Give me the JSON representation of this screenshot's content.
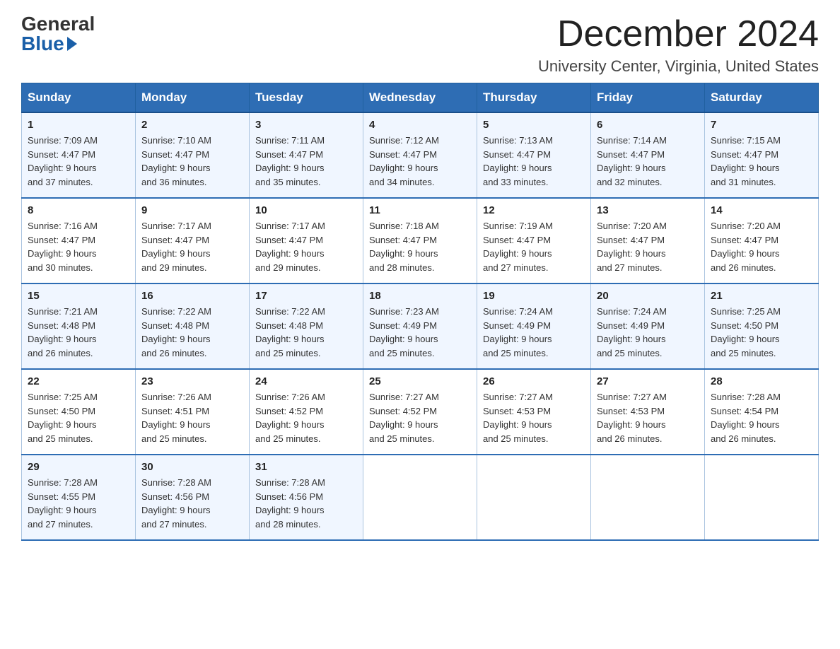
{
  "logo": {
    "general": "General",
    "blue": "Blue"
  },
  "title": "December 2024",
  "location": "University Center, Virginia, United States",
  "days_of_week": [
    "Sunday",
    "Monday",
    "Tuesday",
    "Wednesday",
    "Thursday",
    "Friday",
    "Saturday"
  ],
  "weeks": [
    [
      {
        "day": "1",
        "sunrise": "7:09 AM",
        "sunset": "4:47 PM",
        "daylight": "9 hours and 37 minutes."
      },
      {
        "day": "2",
        "sunrise": "7:10 AM",
        "sunset": "4:47 PM",
        "daylight": "9 hours and 36 minutes."
      },
      {
        "day": "3",
        "sunrise": "7:11 AM",
        "sunset": "4:47 PM",
        "daylight": "9 hours and 35 minutes."
      },
      {
        "day": "4",
        "sunrise": "7:12 AM",
        "sunset": "4:47 PM",
        "daylight": "9 hours and 34 minutes."
      },
      {
        "day": "5",
        "sunrise": "7:13 AM",
        "sunset": "4:47 PM",
        "daylight": "9 hours and 33 minutes."
      },
      {
        "day": "6",
        "sunrise": "7:14 AM",
        "sunset": "4:47 PM",
        "daylight": "9 hours and 32 minutes."
      },
      {
        "day": "7",
        "sunrise": "7:15 AM",
        "sunset": "4:47 PM",
        "daylight": "9 hours and 31 minutes."
      }
    ],
    [
      {
        "day": "8",
        "sunrise": "7:16 AM",
        "sunset": "4:47 PM",
        "daylight": "9 hours and 30 minutes."
      },
      {
        "day": "9",
        "sunrise": "7:17 AM",
        "sunset": "4:47 PM",
        "daylight": "9 hours and 29 minutes."
      },
      {
        "day": "10",
        "sunrise": "7:17 AM",
        "sunset": "4:47 PM",
        "daylight": "9 hours and 29 minutes."
      },
      {
        "day": "11",
        "sunrise": "7:18 AM",
        "sunset": "4:47 PM",
        "daylight": "9 hours and 28 minutes."
      },
      {
        "day": "12",
        "sunrise": "7:19 AM",
        "sunset": "4:47 PM",
        "daylight": "9 hours and 27 minutes."
      },
      {
        "day": "13",
        "sunrise": "7:20 AM",
        "sunset": "4:47 PM",
        "daylight": "9 hours and 27 minutes."
      },
      {
        "day": "14",
        "sunrise": "7:20 AM",
        "sunset": "4:47 PM",
        "daylight": "9 hours and 26 minutes."
      }
    ],
    [
      {
        "day": "15",
        "sunrise": "7:21 AM",
        "sunset": "4:48 PM",
        "daylight": "9 hours and 26 minutes."
      },
      {
        "day": "16",
        "sunrise": "7:22 AM",
        "sunset": "4:48 PM",
        "daylight": "9 hours and 26 minutes."
      },
      {
        "day": "17",
        "sunrise": "7:22 AM",
        "sunset": "4:48 PM",
        "daylight": "9 hours and 25 minutes."
      },
      {
        "day": "18",
        "sunrise": "7:23 AM",
        "sunset": "4:49 PM",
        "daylight": "9 hours and 25 minutes."
      },
      {
        "day": "19",
        "sunrise": "7:24 AM",
        "sunset": "4:49 PM",
        "daylight": "9 hours and 25 minutes."
      },
      {
        "day": "20",
        "sunrise": "7:24 AM",
        "sunset": "4:49 PM",
        "daylight": "9 hours and 25 minutes."
      },
      {
        "day": "21",
        "sunrise": "7:25 AM",
        "sunset": "4:50 PM",
        "daylight": "9 hours and 25 minutes."
      }
    ],
    [
      {
        "day": "22",
        "sunrise": "7:25 AM",
        "sunset": "4:50 PM",
        "daylight": "9 hours and 25 minutes."
      },
      {
        "day": "23",
        "sunrise": "7:26 AM",
        "sunset": "4:51 PM",
        "daylight": "9 hours and 25 minutes."
      },
      {
        "day": "24",
        "sunrise": "7:26 AM",
        "sunset": "4:52 PM",
        "daylight": "9 hours and 25 minutes."
      },
      {
        "day": "25",
        "sunrise": "7:27 AM",
        "sunset": "4:52 PM",
        "daylight": "9 hours and 25 minutes."
      },
      {
        "day": "26",
        "sunrise": "7:27 AM",
        "sunset": "4:53 PM",
        "daylight": "9 hours and 25 minutes."
      },
      {
        "day": "27",
        "sunrise": "7:27 AM",
        "sunset": "4:53 PM",
        "daylight": "9 hours and 26 minutes."
      },
      {
        "day": "28",
        "sunrise": "7:28 AM",
        "sunset": "4:54 PM",
        "daylight": "9 hours and 26 minutes."
      }
    ],
    [
      {
        "day": "29",
        "sunrise": "7:28 AM",
        "sunset": "4:55 PM",
        "daylight": "9 hours and 27 minutes."
      },
      {
        "day": "30",
        "sunrise": "7:28 AM",
        "sunset": "4:56 PM",
        "daylight": "9 hours and 27 minutes."
      },
      {
        "day": "31",
        "sunrise": "7:28 AM",
        "sunset": "4:56 PM",
        "daylight": "9 hours and 28 minutes."
      },
      null,
      null,
      null,
      null
    ]
  ],
  "labels": {
    "sunrise": "Sunrise:",
    "sunset": "Sunset:",
    "daylight": "Daylight:"
  }
}
